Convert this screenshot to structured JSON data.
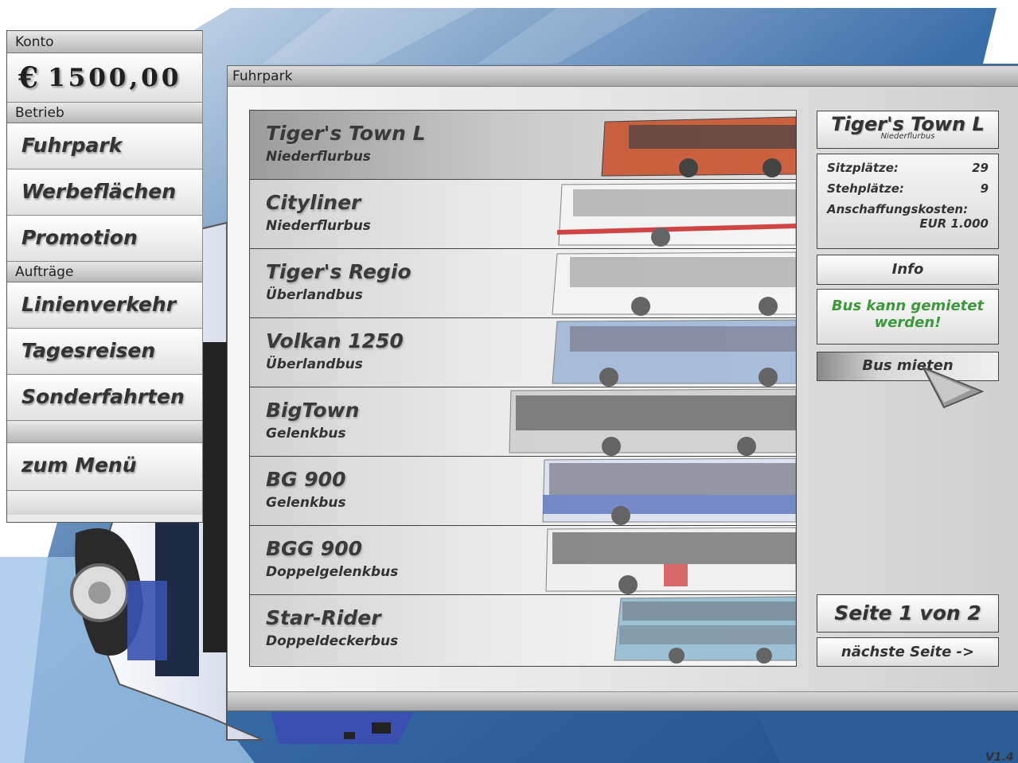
{
  "account": {
    "header": "Konto",
    "currency": "€",
    "balance": "1500,00"
  },
  "menu": {
    "section_betrieb": "Betrieb",
    "fuhrpark": "Fuhrpark",
    "werbeflaechen": "Werbeflächen",
    "promotion": "Promotion",
    "section_auftraege": "Aufträge",
    "linienverkehr": "Linienverkehr",
    "tagesreisen": "Tagesreisen",
    "sonderfahrten": "Sonderfahrten",
    "zum_menu": "zum Menü"
  },
  "panel": {
    "title": "Fuhrpark"
  },
  "buses": [
    {
      "name": "Tiger's Town L",
      "type": "Niederflurbus",
      "color": "#c9532e",
      "selected": true
    },
    {
      "name": "Cityliner",
      "type": "Niederflurbus",
      "color": "#d9d9d9"
    },
    {
      "name": "Tiger's Regio",
      "type": "Überlandbus",
      "color": "#e6e6e6"
    },
    {
      "name": "Volkan 1250",
      "type": "Überlandbus",
      "color": "#9fb7d6"
    },
    {
      "name": "BigTown",
      "type": "Gelenkbus",
      "color": "#8a8a8a"
    },
    {
      "name": "BG 900",
      "type": "Gelenkbus",
      "color": "#8fa3c9"
    },
    {
      "name": "BGG 900",
      "type": "Doppelgelenkbus",
      "color": "#b9b9b9"
    },
    {
      "name": "Star-Rider",
      "type": "Doppeldeckerbus",
      "color": "#93bcd1"
    }
  ],
  "selected_bus": {
    "name": "Tiger's Town L",
    "type": "Niederflurbus",
    "seats_label": "Sitzplätze:",
    "seats": "29",
    "standing_label": "Stehplätze:",
    "standing": "9",
    "cost_label": "Anschaffungskosten:",
    "cost": "EUR 1.000"
  },
  "actions": {
    "info": "Info",
    "status": "Bus kann gemietet werden!",
    "status_color": "#3a9a3a",
    "rent": "Bus mieten"
  },
  "pagination": {
    "label": "Seite 1 von 2",
    "next": "nächste Seite ->"
  },
  "version": "V1.4"
}
